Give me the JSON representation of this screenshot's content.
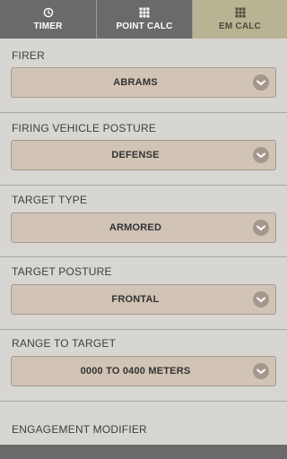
{
  "tabs": [
    {
      "label": "TIMER",
      "icon": "clock-icon",
      "active": false
    },
    {
      "label": "POINT CALC",
      "icon": "grid-icon",
      "active": false
    },
    {
      "label": "EM CALC",
      "icon": "grid-icon",
      "active": true
    }
  ],
  "fields": {
    "firer": {
      "label": "FIRER",
      "value": "ABRAMS"
    },
    "posture": {
      "label": "FIRING VEHICLE POSTURE",
      "value": "DEFENSE"
    },
    "target_type": {
      "label": "TARGET TYPE",
      "value": "ARMORED"
    },
    "target_posture": {
      "label": "TARGET POSTURE",
      "value": "FRONTAL"
    },
    "range": {
      "label": "RANGE TO TARGET",
      "value": "0000 TO 0400 METERS"
    }
  },
  "modifier": {
    "label": "ENGAGEMENT MODIFIER"
  },
  "colors": {
    "tab_bg": "#6a6a6a",
    "tab_active_bg": "#b8b393",
    "page_bg": "#d7d6d3",
    "dropdown_bg": "#d1c3b6",
    "chevron_bg": "#a4988d"
  }
}
